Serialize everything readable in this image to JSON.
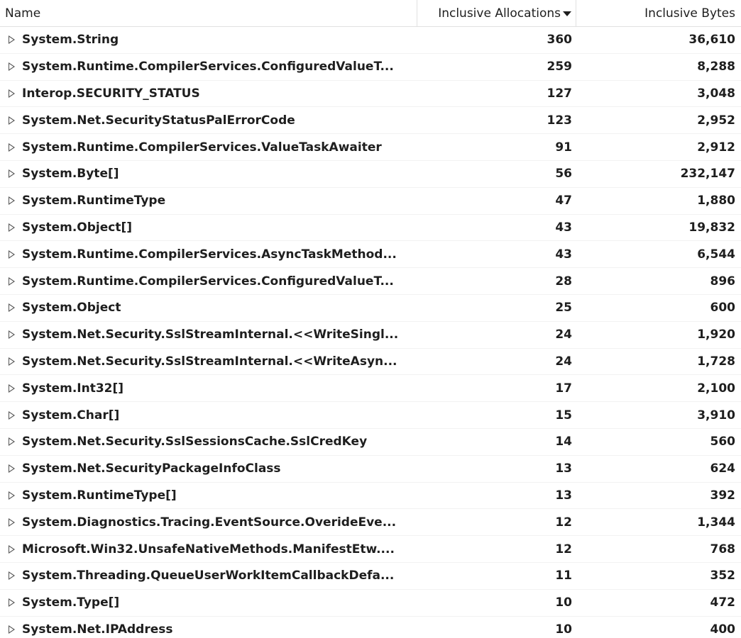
{
  "columns": {
    "name": "Name",
    "inclusive_allocations": "Inclusive Allocations",
    "inclusive_bytes": "Inclusive Bytes"
  },
  "rows": [
    {
      "name": "System.String",
      "allocations": "360",
      "bytes": "36,610"
    },
    {
      "name": "System.Runtime.CompilerServices.ConfiguredValueT...",
      "allocations": "259",
      "bytes": "8,288"
    },
    {
      "name": "Interop.SECURITY_STATUS",
      "allocations": "127",
      "bytes": "3,048"
    },
    {
      "name": "System.Net.SecurityStatusPalErrorCode",
      "allocations": "123",
      "bytes": "2,952"
    },
    {
      "name": "System.Runtime.CompilerServices.ValueTaskAwaiter",
      "allocations": "91",
      "bytes": "2,912"
    },
    {
      "name": "System.Byte[]",
      "allocations": "56",
      "bytes": "232,147"
    },
    {
      "name": "System.RuntimeType",
      "allocations": "47",
      "bytes": "1,880"
    },
    {
      "name": "System.Object[]",
      "allocations": "43",
      "bytes": "19,832"
    },
    {
      "name": "System.Runtime.CompilerServices.AsyncTaskMethod...",
      "allocations": "43",
      "bytes": "6,544"
    },
    {
      "name": "System.Runtime.CompilerServices.ConfiguredValueT...",
      "allocations": "28",
      "bytes": "896"
    },
    {
      "name": "System.Object",
      "allocations": "25",
      "bytes": "600"
    },
    {
      "name": "System.Net.Security.SslStreamInternal.<<WriteSingl...",
      "allocations": "24",
      "bytes": "1,920"
    },
    {
      "name": "System.Net.Security.SslStreamInternal.<<WriteAsyn...",
      "allocations": "24",
      "bytes": "1,728"
    },
    {
      "name": "System.Int32[]",
      "allocations": "17",
      "bytes": "2,100"
    },
    {
      "name": "System.Char[]",
      "allocations": "15",
      "bytes": "3,910"
    },
    {
      "name": "System.Net.Security.SslSessionsCache.SslCredKey",
      "allocations": "14",
      "bytes": "560"
    },
    {
      "name": "System.Net.SecurityPackageInfoClass",
      "allocations": "13",
      "bytes": "624"
    },
    {
      "name": "System.RuntimeType[]",
      "allocations": "13",
      "bytes": "392"
    },
    {
      "name": "System.Diagnostics.Tracing.EventSource.OverideEve...",
      "allocations": "12",
      "bytes": "1,344"
    },
    {
      "name": "Microsoft.Win32.UnsafeNativeMethods.ManifestEtw....",
      "allocations": "12",
      "bytes": "768"
    },
    {
      "name": "System.Threading.QueueUserWorkItemCallbackDefa...",
      "allocations": "11",
      "bytes": "352"
    },
    {
      "name": "System.Type[]",
      "allocations": "10",
      "bytes": "472"
    },
    {
      "name": "System.Net.IPAddress",
      "allocations": "10",
      "bytes": "400"
    }
  ],
  "sort": {
    "column": "inclusive_allocations",
    "direction": "descending"
  },
  "colors": {
    "text": "#1e1e1e",
    "divider": "#e1e1e1",
    "expander": "#555555",
    "background": "#ffffff"
  }
}
